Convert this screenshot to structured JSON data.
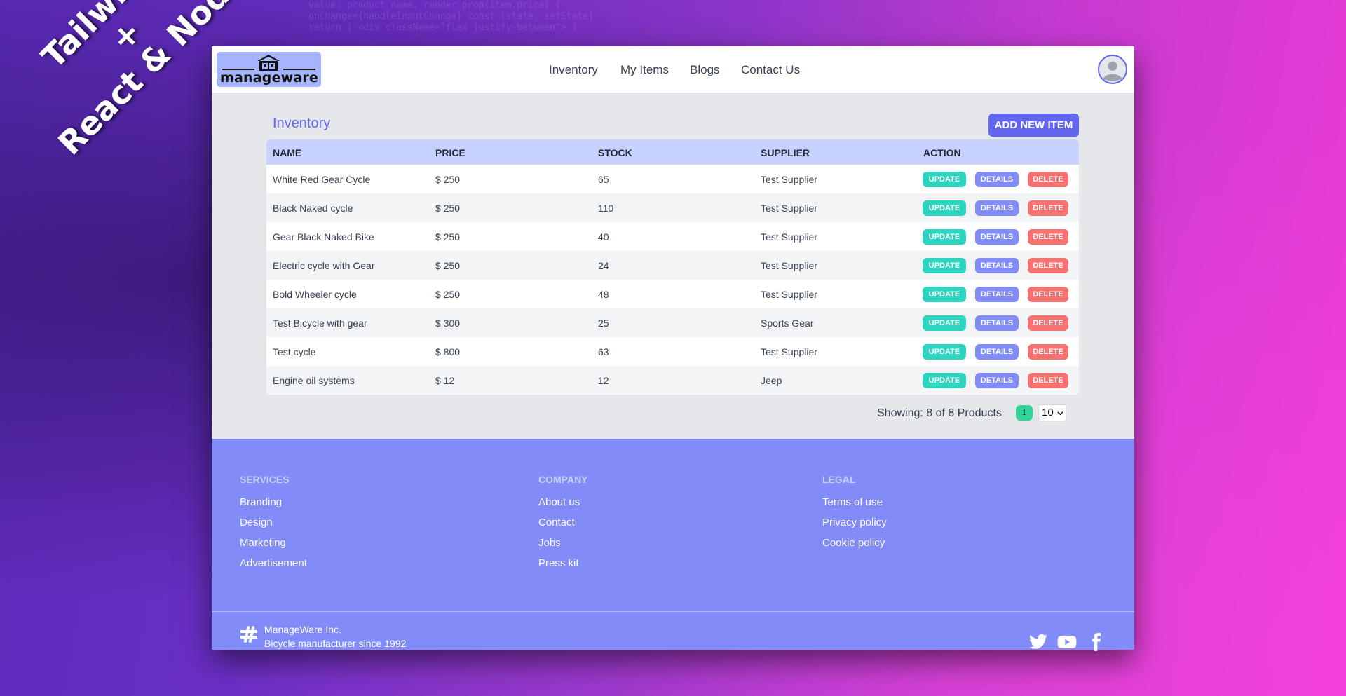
{
  "overlay": {
    "line1": "Tailwind",
    "line2": "+",
    "line3": "React & Node"
  },
  "header": {
    "logo_text": "manageware",
    "nav": [
      "Inventory",
      "My Items",
      "Blogs",
      "Contact Us"
    ]
  },
  "inventory": {
    "title": "Inventory",
    "add_button": "ADD NEW ITEM",
    "columns": [
      "NAME",
      "PRICE",
      "STOCK",
      "SUPPLIER",
      "ACTION"
    ],
    "rows": [
      {
        "name": "White Red Gear Cycle",
        "price": "$ 250",
        "stock": "65",
        "supplier": "Test Supplier"
      },
      {
        "name": "Black Naked cycle",
        "price": "$ 250",
        "stock": "110",
        "supplier": "Test Supplier"
      },
      {
        "name": "Gear Black Naked Bike",
        "price": "$ 250",
        "stock": "40",
        "supplier": "Test Supplier"
      },
      {
        "name": "Electric cycle with Gear",
        "price": "$ 250",
        "stock": "24",
        "supplier": "Test Supplier"
      },
      {
        "name": "Bold Wheeler cycle",
        "price": "$ 250",
        "stock": "48",
        "supplier": "Test Supplier"
      },
      {
        "name": "Test Bicycle with gear",
        "price": "$ 300",
        "stock": "25",
        "supplier": "Sports Gear"
      },
      {
        "name": "Test cycle",
        "price": "$ 800",
        "stock": "63",
        "supplier": "Test Supplier"
      },
      {
        "name": "Engine oil systems",
        "price": "$ 12",
        "stock": "12",
        "supplier": "Jeep"
      }
    ],
    "actions": {
      "update": "UPDATE",
      "details": "DETAILS",
      "delete": "DELETE"
    },
    "showing": "Showing: 8 of 8 Products",
    "page": "1",
    "per_page": "10"
  },
  "footer": {
    "services": {
      "heading": "SERVICES",
      "links": [
        "Branding",
        "Design",
        "Marketing",
        "Advertisement"
      ]
    },
    "company": {
      "heading": "COMPANY",
      "links": [
        "About us",
        "Contact",
        "Jobs",
        "Press kit"
      ]
    },
    "legal": {
      "heading": "LEGAL",
      "links": [
        "Terms of use",
        "Privacy policy",
        "Cookie policy"
      ]
    },
    "brand_name": "ManageWare Inc.",
    "brand_tagline": "Bicycle manufacturer since 1992",
    "social_icons": [
      "twitter-icon",
      "youtube-icon",
      "facebook-icon"
    ]
  },
  "colors": {
    "accent": "#6366f1",
    "header_row": "#c7d2fe",
    "footer": "#818cf8",
    "update": "#2dd4bf",
    "details": "#818cf8",
    "delete": "#f87171"
  }
}
